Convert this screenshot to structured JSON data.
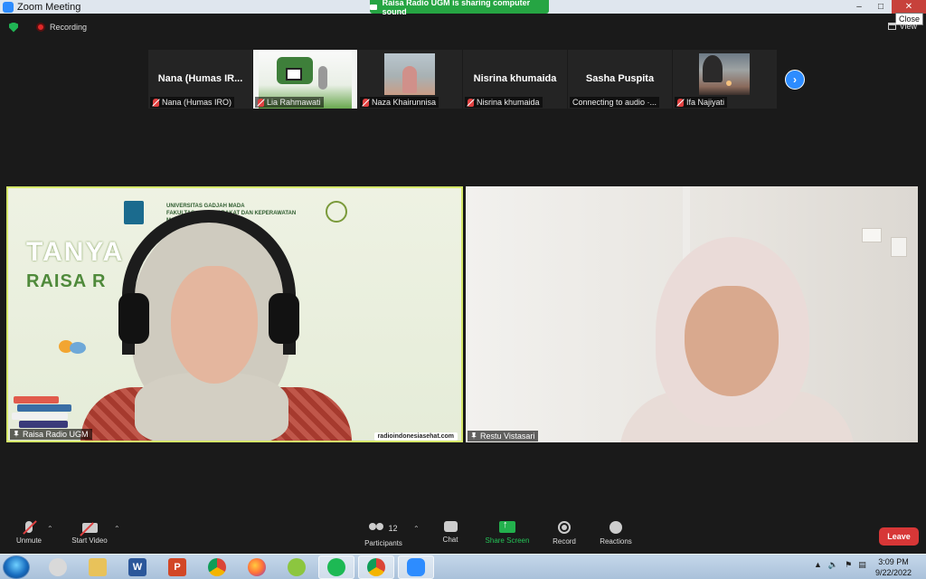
{
  "window": {
    "title": "Zoom Meeting",
    "share_banner": "Raisa Radio UGM is sharing computer sound",
    "close_tooltip": "Close"
  },
  "status": {
    "recording_label": "Recording",
    "view_label": "View"
  },
  "participants_strip": [
    {
      "big_name": "Nana (Humas IR...",
      "tag": "Nana (Humas IRO)",
      "muted": true,
      "video": false
    },
    {
      "big_name": "",
      "tag": "Lia Rahmawati",
      "muted": true,
      "video": true,
      "icon": "poster-video"
    },
    {
      "big_name": "",
      "tag": "Naza Khairunnisa",
      "muted": true,
      "video": true,
      "icon": "person-photo"
    },
    {
      "big_name": "Nisrina khumaida",
      "tag": "Nisrina khumaida",
      "muted": true,
      "video": false
    },
    {
      "big_name": "Sasha Puspita",
      "tag": "Connecting to audio ·...",
      "muted": false,
      "video": false
    },
    {
      "big_name": "",
      "tag": "Ifa Najiyati",
      "muted": true,
      "video": true,
      "icon": "sunset-photo"
    }
  ],
  "main_videos": {
    "left": {
      "name": "Raisa Radio UGM",
      "banner_heading_1": "UNIVERSITAS GADJAH MADA",
      "banner_heading_2": "FAKULTAS ... MASYARAKAT DAN KEPERAWATAN",
      "banner_heading_3": "MANAJEMEN KESEHATAN",
      "banner_heading_4": "... KESEHATAN",
      "banner_title_1": "TANYA",
      "banner_title_2": "RAISA R",
      "site_url": "radioindonesiasehat.com"
    },
    "right": {
      "name": "Restu Vistasari"
    }
  },
  "toolbar": {
    "unmute": "Unmute",
    "start_video": "Start Video",
    "participants": "Participants",
    "participants_count": "12",
    "chat": "Chat",
    "share_screen": "Share Screen",
    "record": "Record",
    "reactions": "Reactions",
    "leave": "Leave"
  },
  "taskbar": {
    "apps": [
      "file-explorer",
      "paint",
      "word",
      "powerpoint",
      "chrome",
      "firefox",
      "app-green",
      "spotify",
      "chrome-profile",
      "zoom"
    ],
    "clock_time": "3:09 PM",
    "clock_date": "9/22/2022"
  },
  "colors": {
    "accent": "#2d8cff",
    "share_green": "#26a543",
    "leave_red": "#d73737",
    "active_speaker": "#d6e86a"
  }
}
